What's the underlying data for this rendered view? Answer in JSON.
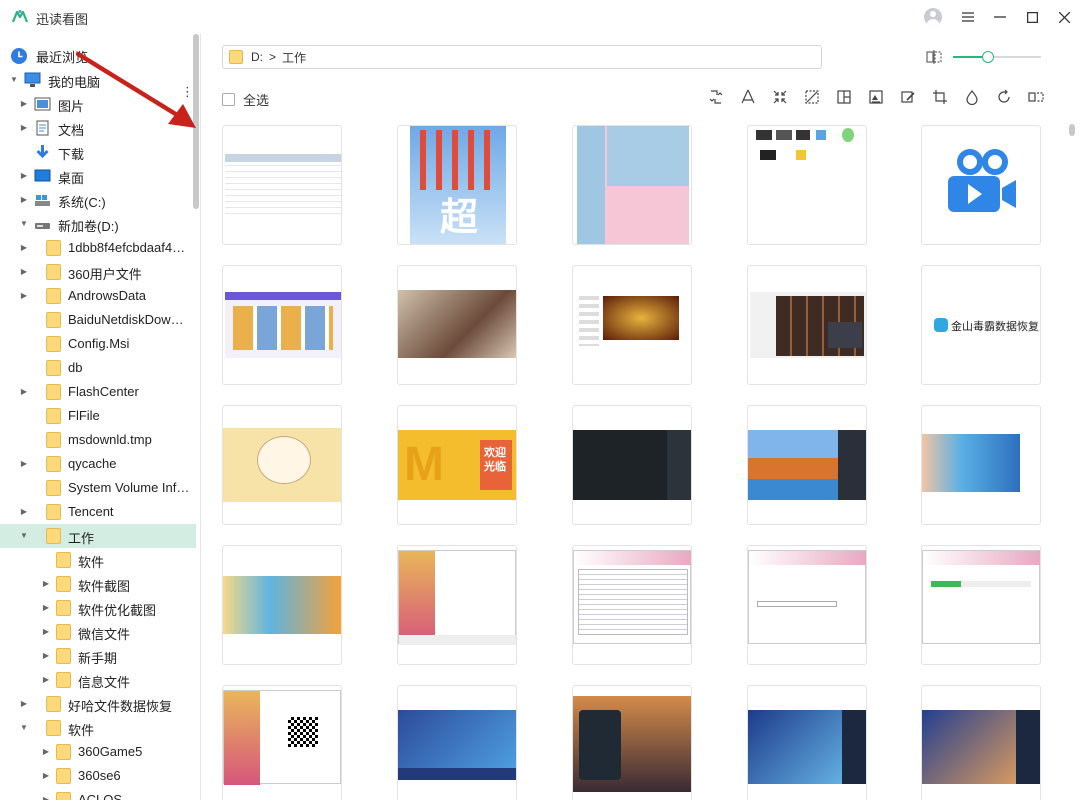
{
  "app": {
    "title": "迅读看图",
    "accent": "#2db37e"
  },
  "window": {
    "icons": [
      "user-avatar-icon",
      "menu-icon",
      "minimize-icon",
      "maximize-icon",
      "close-icon"
    ]
  },
  "sidebar": {
    "recent_label": "最近浏览",
    "items": [
      {
        "label": "我的电脑",
        "level": 0,
        "expanded": true,
        "icon": "computer-icon"
      },
      {
        "label": "图片",
        "level": 1,
        "icon": "pictures-icon"
      },
      {
        "label": "文档",
        "level": 1,
        "icon": "documents-icon"
      },
      {
        "label": "下载",
        "level": 1,
        "icon": "download-icon"
      },
      {
        "label": "桌面",
        "level": 1,
        "icon": "desktop-icon"
      },
      {
        "label": "系统(C:)",
        "level": 1,
        "icon": "drive-c-icon"
      },
      {
        "label": "新加卷(D:)",
        "level": 1,
        "expanded": true,
        "icon": "drive-icon"
      },
      {
        "label": "1dbb8f4efcbdaaf40...",
        "level": 2,
        "icon": "folder-icon"
      },
      {
        "label": "360用户文件",
        "level": 2,
        "icon": "folder-icon"
      },
      {
        "label": "AndrowsData",
        "level": 2,
        "icon": "folder-icon"
      },
      {
        "label": "BaiduNetdiskDownl...",
        "level": 2,
        "icon": "folder-icon"
      },
      {
        "label": "Config.Msi",
        "level": 2,
        "icon": "folder-icon"
      },
      {
        "label": "db",
        "level": 2,
        "icon": "folder-icon"
      },
      {
        "label": "FlashCenter",
        "level": 2,
        "icon": "folder-icon"
      },
      {
        "label": "FlFile",
        "level": 2,
        "icon": "folder-icon"
      },
      {
        "label": "msdownld.tmp",
        "level": 2,
        "icon": "folder-icon"
      },
      {
        "label": "qycache",
        "level": 2,
        "icon": "folder-icon"
      },
      {
        "label": "System Volume Info...",
        "level": 2,
        "icon": "folder-icon"
      },
      {
        "label": "Tencent",
        "level": 2,
        "icon": "folder-icon"
      },
      {
        "label": "工作",
        "level": 2,
        "expanded": true,
        "selected": true,
        "icon": "folder-icon"
      },
      {
        "label": "软件",
        "level": 3,
        "icon": "folder-icon"
      },
      {
        "label": "软件截图",
        "level": 3,
        "icon": "folder-icon"
      },
      {
        "label": "软件优化截图",
        "level": 3,
        "icon": "folder-icon"
      },
      {
        "label": "微信文件",
        "level": 3,
        "icon": "folder-icon"
      },
      {
        "label": "新手期",
        "level": 3,
        "icon": "folder-icon"
      },
      {
        "label": "信息文件",
        "level": 3,
        "icon": "folder-icon"
      },
      {
        "label": "好哈文件数据恢复",
        "level": 2,
        "icon": "folder-icon"
      },
      {
        "label": "软件",
        "level": 2,
        "expanded": true,
        "icon": "folder-icon"
      },
      {
        "label": "360Game5",
        "level": 3,
        "icon": "folder-icon"
      },
      {
        "label": "360se6",
        "level": 3,
        "icon": "folder-icon"
      },
      {
        "label": "ACLOS",
        "level": 3,
        "icon": "folder-icon"
      }
    ]
  },
  "path": {
    "segments": [
      "D:",
      ">",
      "工作"
    ]
  },
  "zoom": {
    "level": 0.4
  },
  "select_all_label": "全选",
  "toolbar": {
    "tools": [
      "convert-format-icon",
      "to-pdf-icon",
      "compress-icon",
      "remove-watermark-icon",
      "split-icon",
      "add-watermark-icon",
      "batch-edit-icon",
      "crop-icon",
      "color-icon",
      "rotate-icon",
      "mirror-icon"
    ]
  },
  "thumbnails": [
    {
      "kind": "screenshot-spreadsheet"
    },
    {
      "kind": "screenshot-desktop-icons"
    },
    {
      "kind": "screenshot-chat"
    },
    {
      "kind": "screenshot-file-icons"
    },
    {
      "kind": "video-file-icon"
    },
    {
      "kind": "screenshot-browser"
    },
    {
      "kind": "anime-group"
    },
    {
      "kind": "screenshot-game-site"
    },
    {
      "kind": "screenshot-game-store"
    },
    {
      "kind": "brand-logo",
      "text": "金山毒霸数据恢复"
    },
    {
      "kind": "cartoon-bear"
    },
    {
      "kind": "mcdonalds-ad",
      "text": "欢迎光临"
    },
    {
      "kind": "screenshot-dark-app"
    },
    {
      "kind": "screenshot-race-game"
    },
    {
      "kind": "screenshot-dance-game"
    },
    {
      "kind": "dance-game-banner"
    },
    {
      "kind": "installer-welcome"
    },
    {
      "kind": "installer-license"
    },
    {
      "kind": "installer-path"
    },
    {
      "kind": "installer-progress"
    },
    {
      "kind": "installer-qrcode"
    },
    {
      "kind": "game-login-banner"
    },
    {
      "kind": "game-character-menu"
    },
    {
      "kind": "game-launcher"
    },
    {
      "kind": "game-launcher-2"
    }
  ]
}
